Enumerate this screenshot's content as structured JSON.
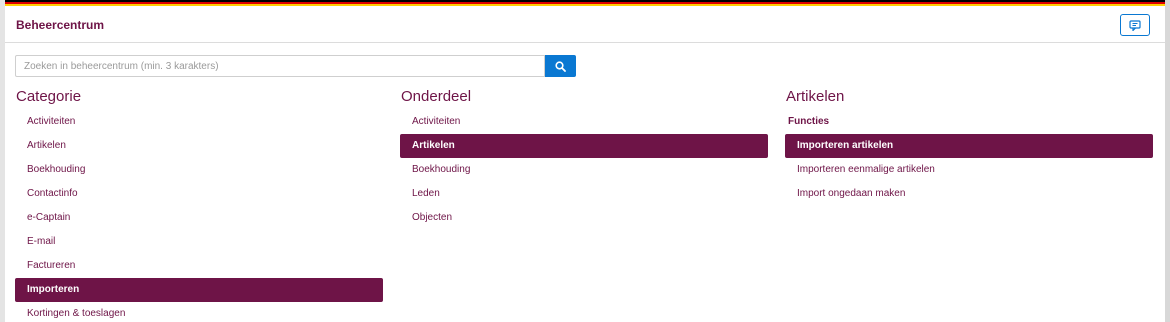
{
  "header": {
    "title": "Beheercentrum",
    "chat_icon": "chat-icon"
  },
  "search": {
    "placeholder": "Zoeken in beheercentrum (min. 3 karakters)",
    "value": "",
    "icon": "search-icon"
  },
  "categorie": {
    "heading": "Categorie",
    "items": [
      {
        "label": "Activiteiten"
      },
      {
        "label": "Artikelen"
      },
      {
        "label": "Boekhouding"
      },
      {
        "label": "Contactinfo"
      },
      {
        "label": "e-Captain"
      },
      {
        "label": "E-mail"
      },
      {
        "label": "Factureren"
      },
      {
        "label": "Importeren",
        "active": true
      },
      {
        "label": "Kortingen & toeslagen"
      }
    ]
  },
  "onderdeel": {
    "heading": "Onderdeel",
    "items": [
      {
        "label": "Activiteiten"
      },
      {
        "label": "Artikelen",
        "active": true
      },
      {
        "label": "Boekhouding"
      },
      {
        "label": "Leden"
      },
      {
        "label": "Objecten"
      }
    ]
  },
  "artikelen": {
    "heading": "Artikelen",
    "section": "Functies",
    "items": [
      {
        "label": "Importeren artikelen",
        "active": true
      },
      {
        "label": "Importeren eenmalige artikelen"
      },
      {
        "label": "Import ongedaan maken"
      }
    ]
  },
  "colors": {
    "brand": "#6e1447",
    "accent": "#0a78d2"
  }
}
